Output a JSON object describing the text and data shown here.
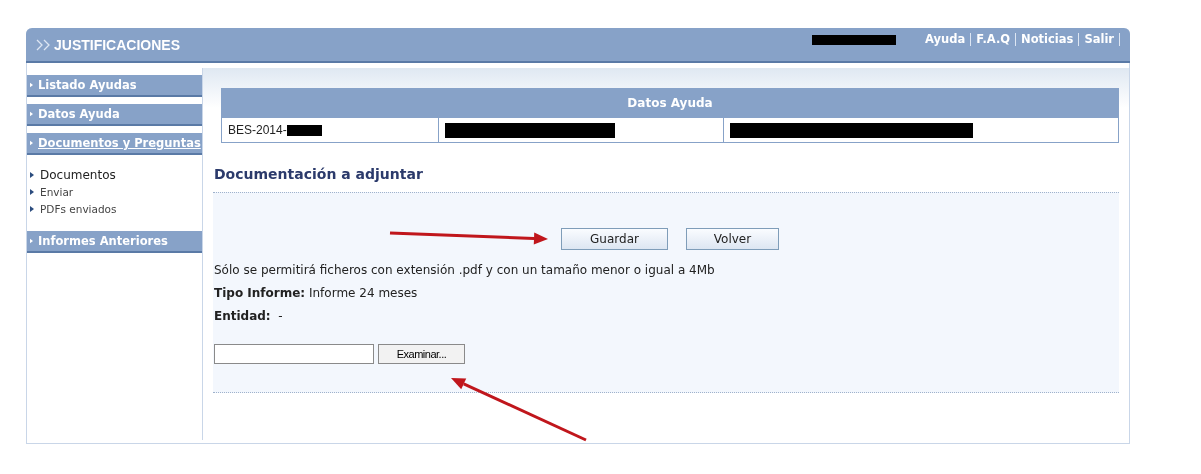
{
  "header": {
    "title": "JUSTIFICACIONES",
    "user_redacted": true,
    "links": [
      "Ayuda",
      "F.A.Q",
      "Noticias",
      "Salir"
    ]
  },
  "sidebar": {
    "items": [
      {
        "label": "Listado Ayudas",
        "selected": false
      },
      {
        "label": "Datos Ayuda",
        "selected": false
      },
      {
        "label": "Documentos y Preguntas",
        "selected": true,
        "children": [
          {
            "label": "Documentos",
            "selected": true
          },
          {
            "label": "Enviar",
            "selected": false
          },
          {
            "label": "PDFs enviados",
            "selected": false
          }
        ]
      },
      {
        "label": "Informes Anteriores",
        "selected": false
      }
    ]
  },
  "table": {
    "title": "Datos Ayuda",
    "rows": [
      [
        {
          "text": "BES-2014-",
          "redacted": true
        },
        {
          "redacted": true
        },
        {
          "redacted": true
        }
      ]
    ]
  },
  "section": {
    "title": "Documentación a adjuntar",
    "buttons": [
      {
        "label": "Guardar",
        "kind": "save",
        "arrow_annotation": true
      },
      {
        "label": "Volver",
        "kind": "back",
        "arrow_annotation": false
      }
    ],
    "note": "Sólo se permitirá ficheros con extensión .pdf y con un tamaño menor o igual a 4Mb",
    "fields": [
      "**Tipo Informe:** Informe 24 meses",
      "**Entidad:**  -"
    ],
    "file_input": {
      "button": "Examinar...",
      "arrow_annotation": true
    }
  }
}
